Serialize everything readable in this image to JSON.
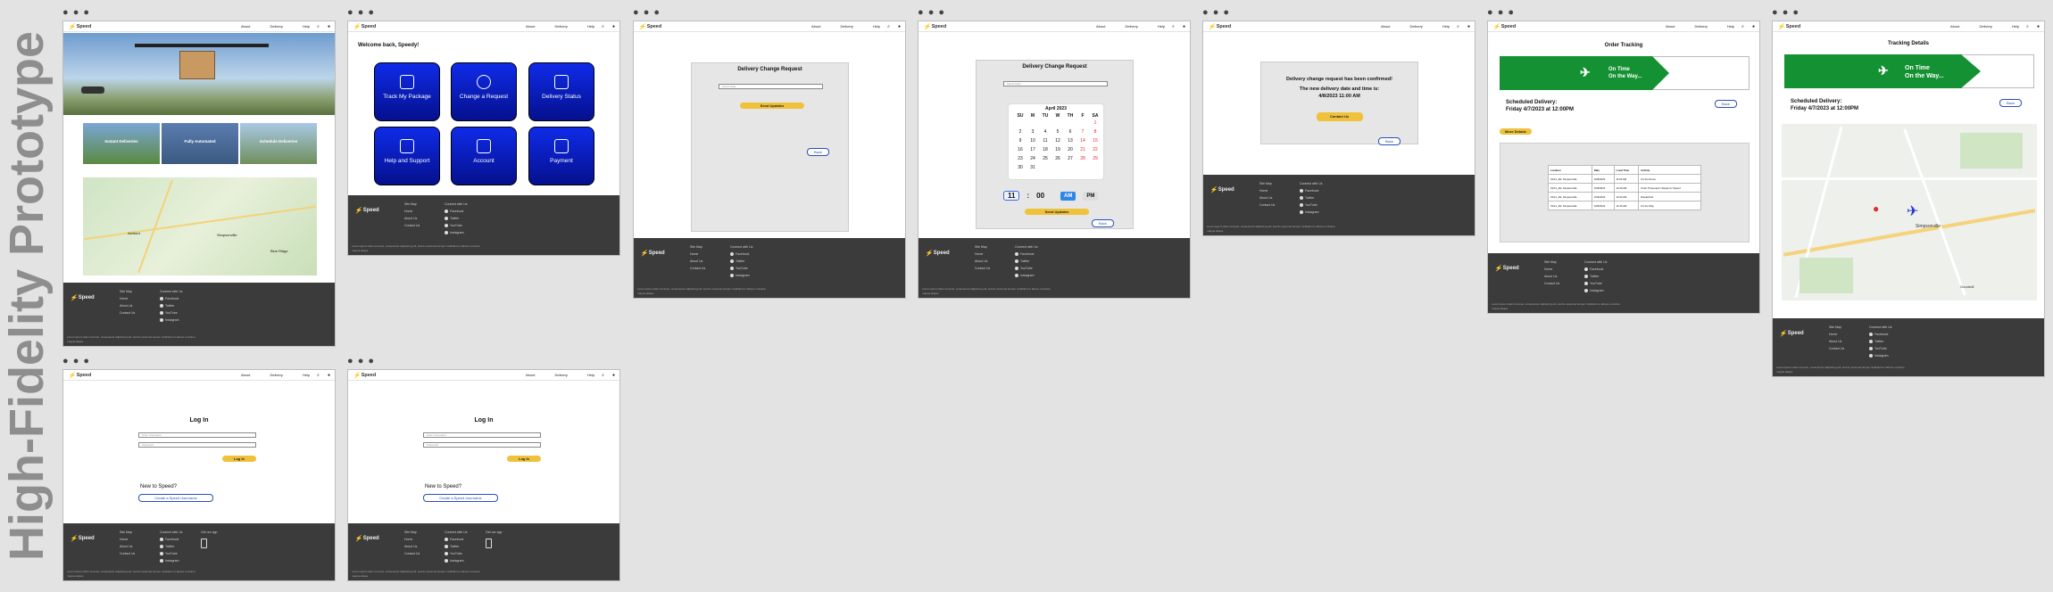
{
  "title": "High-Fidelity Prototype",
  "brand": "Speed",
  "nav": {
    "links": [
      "About",
      "Delivery",
      "Help"
    ]
  },
  "footer": {
    "site_map": "Site Map",
    "site_links": [
      "Home",
      "About Us",
      "Contact Us"
    ],
    "connect": "Connect with Us",
    "social": [
      "Facebook",
      "Twitter",
      "YouTube",
      "Instagram"
    ],
    "app": "Get our app",
    "copyright": "Lorem ipsum dolor sit amet, consectetur adipiscing elit, sed do eiusmod tempor incididunt ut labore et dolore magna aliqua."
  },
  "home": {
    "cards": [
      "Instant Deliveries",
      "Fully Automated",
      "Schedule Deliveries"
    ],
    "map_labels": [
      "Ashford",
      "Simpsonville",
      "Blue Ridge"
    ]
  },
  "dashboard": {
    "welcome": "Welcome back, Speedy!",
    "tiles": [
      "Track My Package",
      "Change a Request",
      "Delivery Status",
      "Help and Support",
      "Account",
      "Payment"
    ]
  },
  "change": {
    "title": "Delivery Change Request",
    "placeholder": "Select Date",
    "send": "Send Updates",
    "back": "Back"
  },
  "calendar": {
    "month": "April",
    "year": "2023",
    "days": [
      "SU",
      "M",
      "TU",
      "W",
      "TH",
      "F",
      "SA"
    ],
    "dates": [
      "",
      "",
      "",
      "",
      "",
      "",
      "1",
      "2",
      "3",
      "4",
      "5",
      "6",
      "7",
      "8",
      "9",
      "10",
      "11",
      "12",
      "13",
      "14",
      "15",
      "16",
      "17",
      "18",
      "19",
      "20",
      "21",
      "22",
      "23",
      "24",
      "25",
      "26",
      "27",
      "28",
      "29",
      "30",
      "31"
    ],
    "hour": "11",
    "minute": "00",
    "am": "AM",
    "pm": "PM"
  },
  "confirm": {
    "line1": "Delivery change request has been confirmed!",
    "line2": "The new delivery date and time is:",
    "line3": "4/8/2023 11:00 AM",
    "contact": "Contact Us",
    "back": "Back"
  },
  "order": {
    "title": "Order Tracking",
    "status1": "On Time",
    "status2": "On the Way...",
    "sched_label": "Scheduled Delivery:",
    "sched": "Friday 4/7/2023 at 12:00PM",
    "back": "Back",
    "more": "More Details",
    "headers": [
      "Location",
      "Date",
      "Local Time",
      "Activity"
    ],
    "rows": [
      [
        "Flint's_Rd, Simpsonville",
        "4/06/2023",
        "11:00 AM",
        "On the Drone"
      ],
      [
        "Flint's_Rd, Simpsonville",
        "4/06/2023",
        "10:45 AM",
        "Order Processed / Ready for Speed"
      ],
      [
        "Flint's_Rd, Simpsonville",
        "4/06/2023",
        "10:30 AM",
        "Dispatched"
      ],
      [
        "Flint's_Rd, Simpsonville",
        "4/06/2023",
        "10:15 AM",
        "On the Way"
      ]
    ]
  },
  "details": {
    "title": "Tracking Details",
    "map_labels": [
      "Simpsonville",
      "Goodwill"
    ]
  },
  "login": {
    "title": "Log In",
    "user": "Enter Username",
    "pass": "Password",
    "btn": "Log In",
    "new": "New to Speed?",
    "create": "Create a Speed Username"
  },
  "colors": {
    "accent": "#f0c13a",
    "tile": "#0a1fd0",
    "green": "#149132",
    "footer": "#3b3b3b"
  }
}
